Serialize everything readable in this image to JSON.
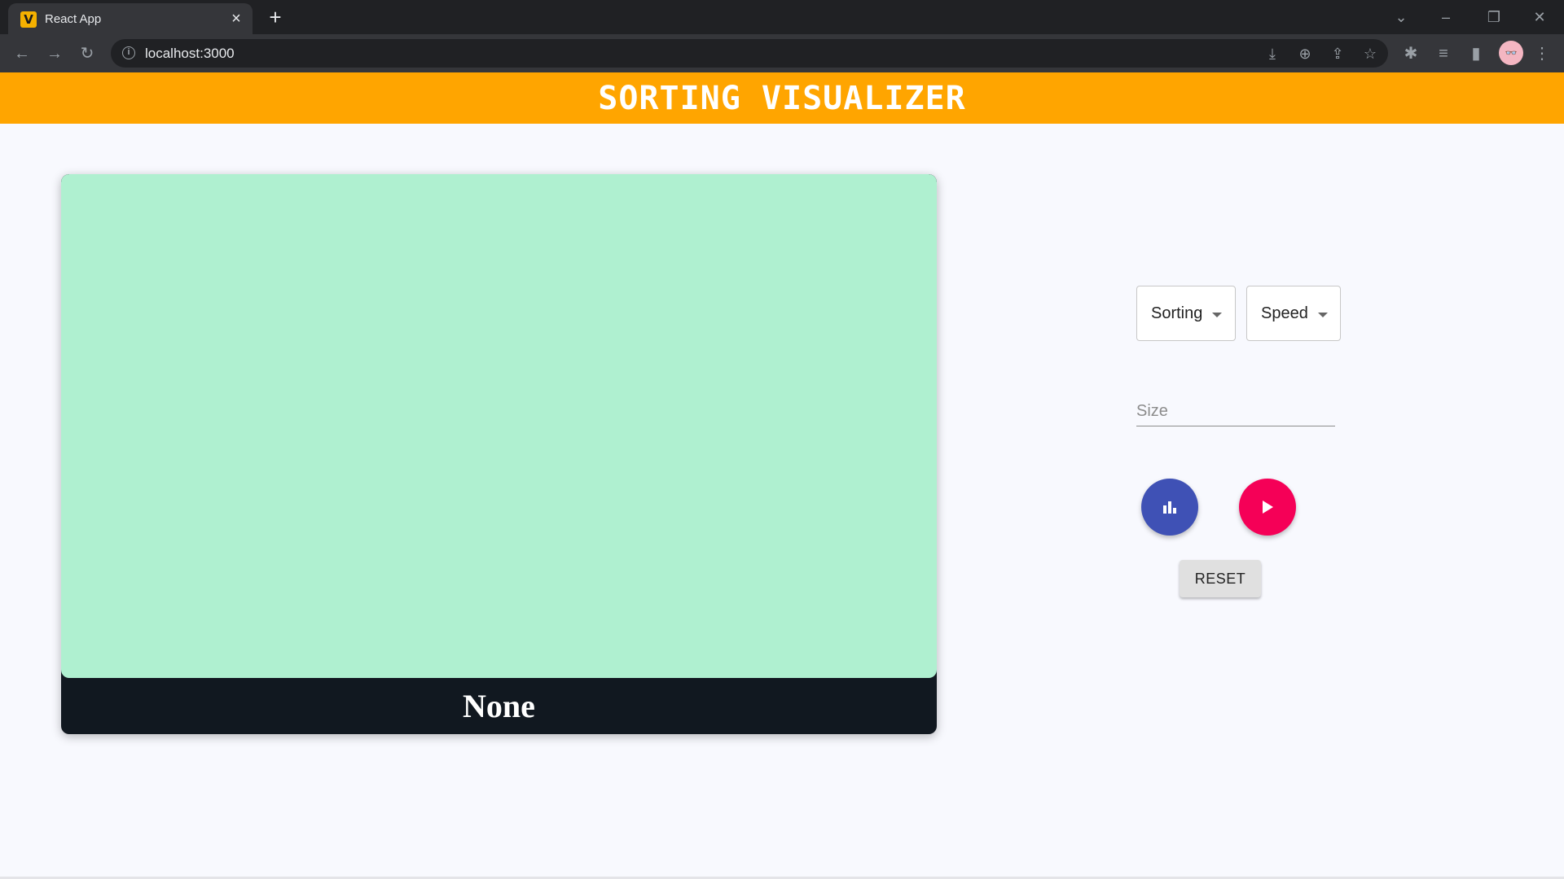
{
  "browser": {
    "tab_title": "React App",
    "tab_favicon_letter": "V",
    "tab_close": "×",
    "new_tab": "+",
    "url": "localhost:3000",
    "profile_initials": "👓"
  },
  "app": {
    "title": "SORTING VISUALIZER",
    "current_algorithm": "None",
    "sorting_select_label": "Sorting",
    "speed_select_label": "Speed",
    "size_placeholder": "Size",
    "reset_label": "RESET"
  },
  "colors": {
    "header": "#ffa500",
    "viz_background": "#aff0d0",
    "viz_footer": "#111820",
    "generate_button": "#3f51b5",
    "play_button": "#f50057"
  },
  "icons": {
    "generate_button": "bar-chart-icon",
    "play_button": "play-icon"
  }
}
